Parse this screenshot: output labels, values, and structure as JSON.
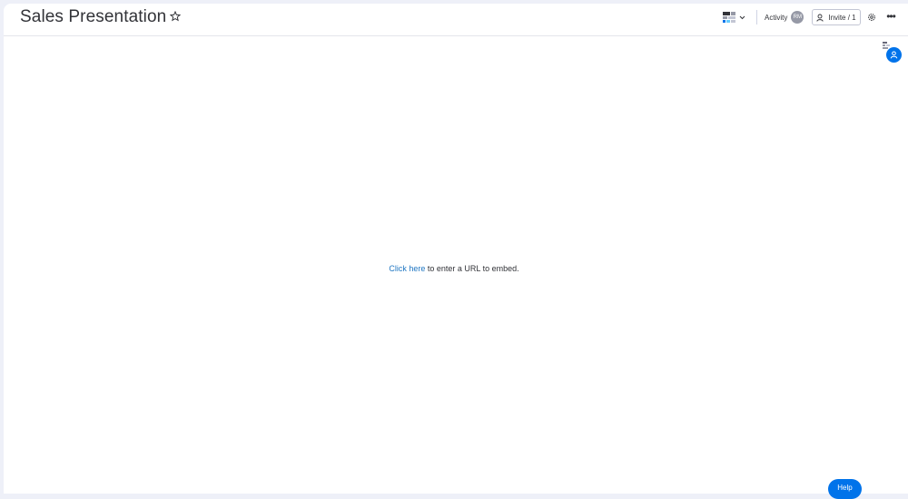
{
  "header": {
    "title": "Sales Presentation",
    "activity_label": "Activity",
    "activity_avatar": "RM",
    "invite_label": "Invite / 1"
  },
  "embed": {
    "link_text": "Click here",
    "rest_text": " to enter a URL to embed."
  },
  "help": {
    "label": "Help"
  },
  "icons": {
    "star": "star-icon",
    "view": "board-view-icon",
    "chevron": "chevron-down-icon",
    "invite": "person-add-icon",
    "gear": "gear-icon",
    "more": "more-icon",
    "user": "user-icon"
  },
  "colors": {
    "accent": "#0073ea",
    "link": "#1f76c2",
    "background": "#eef0f8"
  }
}
